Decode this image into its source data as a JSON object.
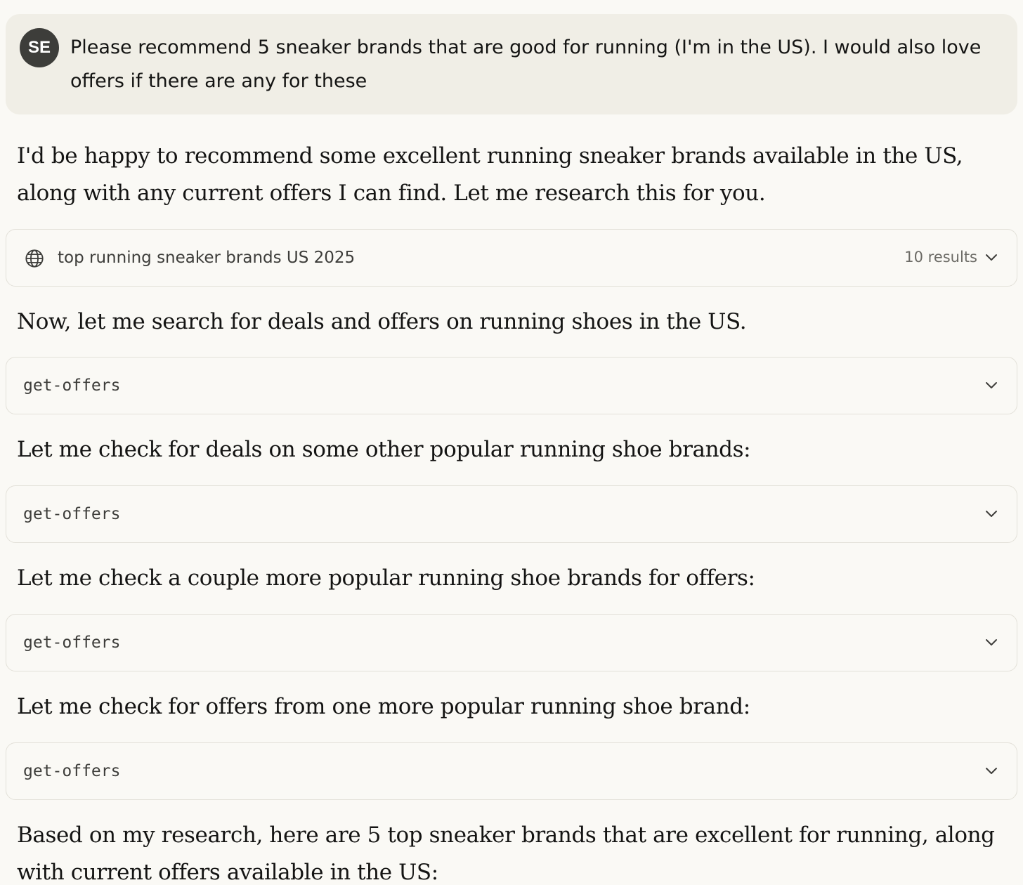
{
  "user_message": {
    "avatar_initials": "SE",
    "text": "Please recommend 5 sneaker brands that are good for running (I'm in the US). I would also love offers if there are any for these"
  },
  "assistant": {
    "intro": "I'd be happy to recommend some excellent running sneaker brands available in the US, along with any current offers I can find. Let me research this for you.",
    "web_search": {
      "icon": "globe-icon",
      "query": "top running sneaker brands US 2025",
      "results_label": "10 results"
    },
    "step_1": "Now, let me search for deals and offers on running shoes in the US.",
    "tool_1": "get-offers",
    "step_2": "Let me check for deals on some other popular running shoe brands:",
    "tool_2": "get-offers",
    "step_3": "Let me check a couple more popular running shoe brands for offers:",
    "tool_3": "get-offers",
    "step_4": "Let me check for offers from one more popular running shoe brand:",
    "tool_4": "get-offers",
    "summary": "Based on my research, here are 5 top sneaker brands that are excellent for running, along with current offers available in the US:"
  },
  "colors": {
    "background": "#faf9f5",
    "user_bubble": "#f0eee6",
    "avatar": "#3d3d3a",
    "card_border": "#e3e1d9",
    "text": "#141413",
    "muted_text": "#6b6a65"
  }
}
